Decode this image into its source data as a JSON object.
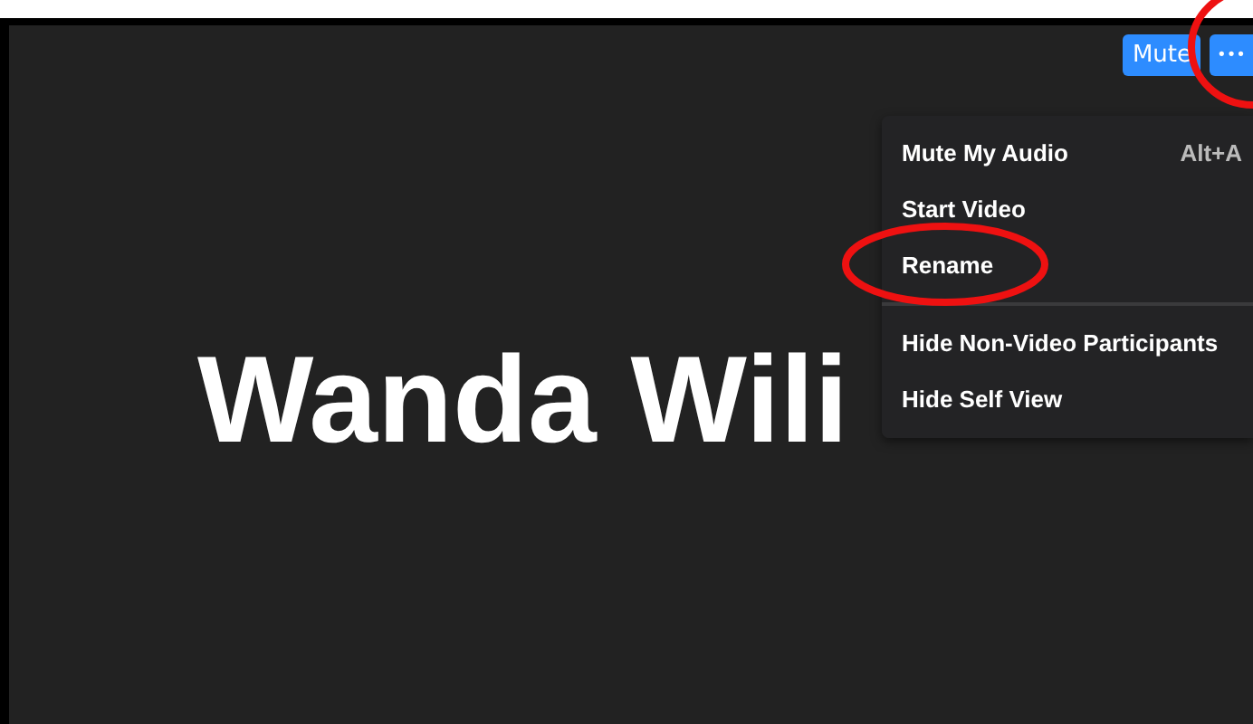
{
  "video_tile": {
    "participant_name": "Wanda Wili"
  },
  "toolbar": {
    "buttons": [
      {
        "kind": "text",
        "label": "Mute"
      },
      {
        "kind": "more",
        "label": "•••"
      }
    ]
  },
  "menu": {
    "items": [
      {
        "kind": "item",
        "label": "Mute My Audio",
        "shortcut": "Alt+A"
      },
      {
        "kind": "item",
        "label": "Start Video"
      },
      {
        "kind": "item",
        "label": "Rename"
      },
      {
        "kind": "divider"
      },
      {
        "kind": "item",
        "label": "Hide Non-Video Participants"
      },
      {
        "kind": "item",
        "label": "Hide Self View"
      }
    ]
  }
}
